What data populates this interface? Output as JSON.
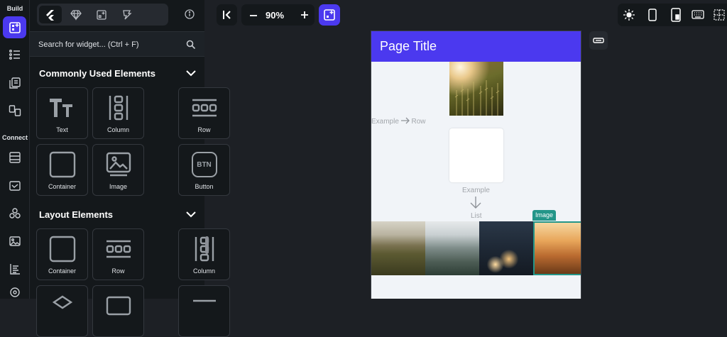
{
  "rail": {
    "build_label": "Build",
    "connect_label": "Connect"
  },
  "panel": {
    "tabs": [
      "flutter-logo-icon",
      "diamond-icon",
      "widget-icon",
      "template-icon"
    ],
    "search_placeholder": "Search for widget... (Ctrl + F)",
    "common_title": "Commonly Used Elements",
    "common": [
      {
        "label": "Text",
        "icon": "text-icon"
      },
      {
        "label": "Column",
        "icon": "column-icon"
      },
      {
        "label": "Row",
        "icon": "row-icon"
      },
      {
        "label": "Container",
        "icon": "container-icon"
      },
      {
        "label": "Image",
        "icon": "image-icon"
      },
      {
        "label": "Button",
        "icon": "button-icon"
      }
    ],
    "layout_title": "Layout Elements",
    "layout": [
      {
        "label": "Container",
        "icon": "container-icon"
      },
      {
        "label": "Row",
        "icon": "row-icon"
      },
      {
        "label": "Column",
        "icon": "column-icon"
      }
    ]
  },
  "toolbar": {
    "zoom": "90%",
    "btn_glyph": "BTN"
  },
  "canvas": {
    "page_title": "Page Title",
    "row_example_a": "Example",
    "row_example_b": "Row",
    "list_example_a": "Example",
    "list_example_b": "List",
    "selected_tag": "Image"
  },
  "colors": {
    "accent": "#4b39ef",
    "selection": "#249689",
    "bg": "#1d2025",
    "panel": "#14181b"
  }
}
